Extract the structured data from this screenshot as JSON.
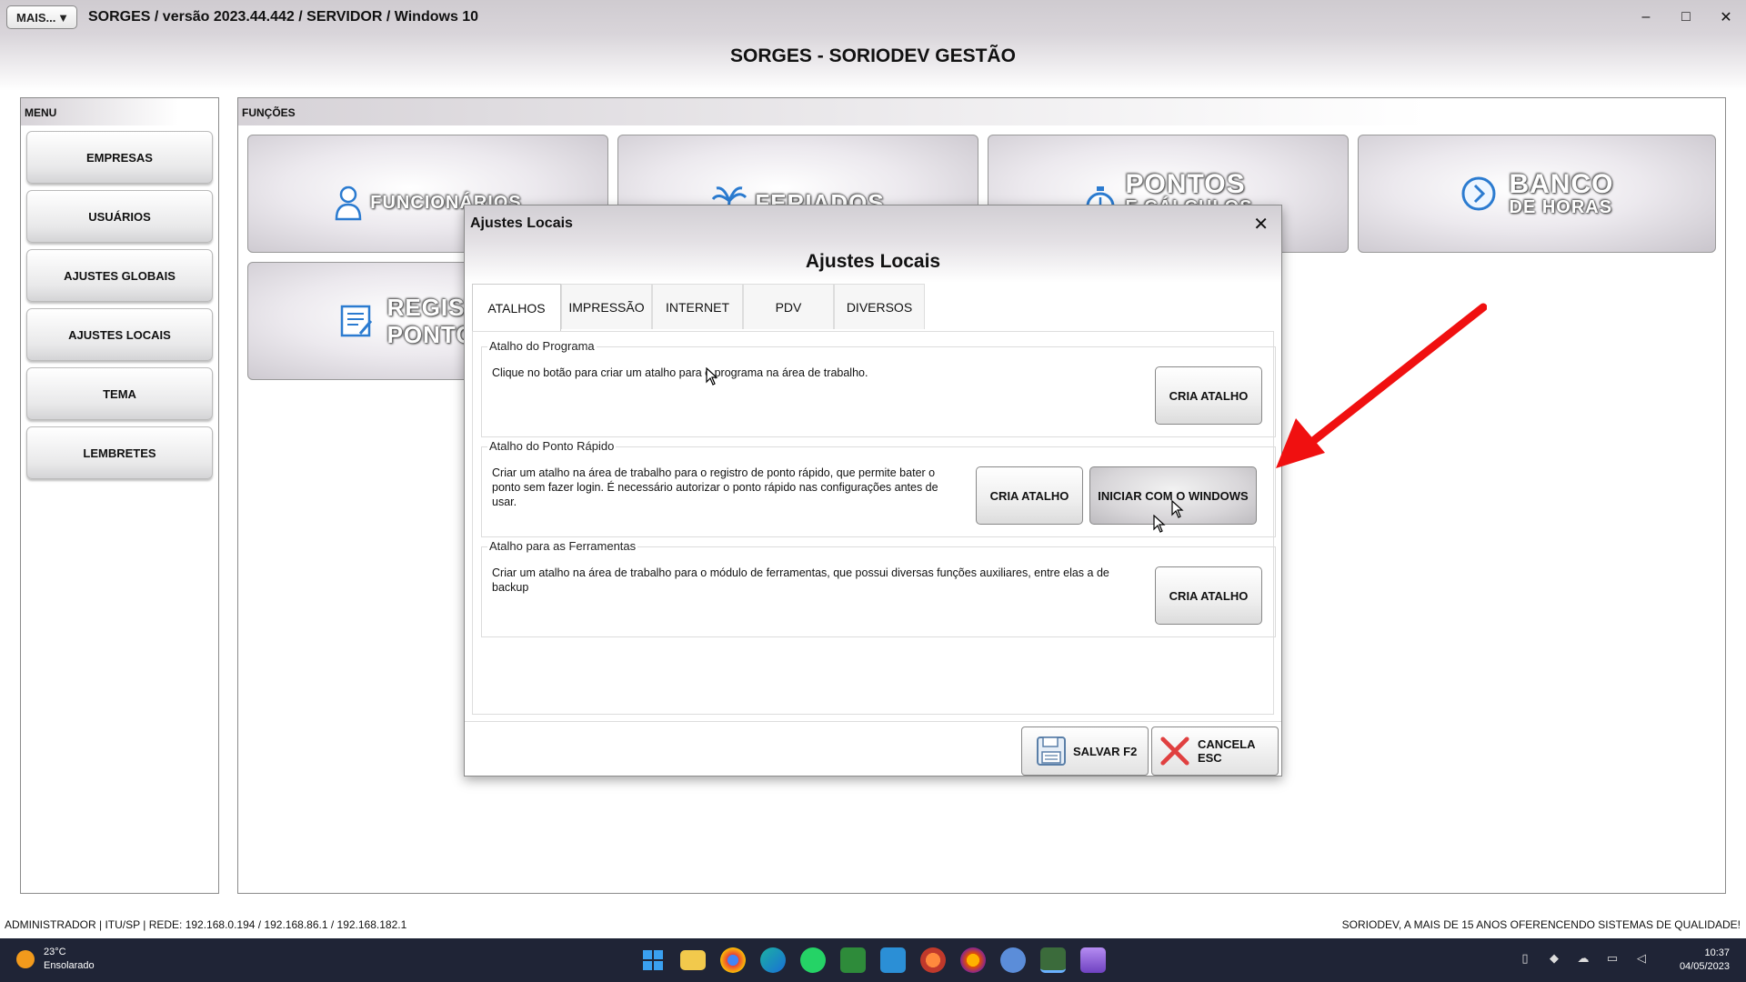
{
  "window": {
    "mais_label": "MAIS...",
    "title": "SORGES / versão 2023.44.442 / SERVIDOR / Windows 10",
    "minimize": "–",
    "maximize": "□",
    "close": "✕"
  },
  "header": {
    "title": "SORGES - SORIODEV GESTÃO"
  },
  "menu": {
    "heading": "MENU",
    "items": [
      {
        "label": "EMPRESAS"
      },
      {
        "label": "USUÁRIOS"
      },
      {
        "label": "AJUSTES GLOBAIS"
      },
      {
        "label": "AJUSTES LOCAIS"
      },
      {
        "label": "TEMA"
      },
      {
        "label": "LEMBRETES"
      }
    ]
  },
  "functions": {
    "heading": "FUNÇÕES",
    "tiles": [
      {
        "line1": "FUNCIONÁRIOS",
        "icon": "employee-icon"
      },
      {
        "line1": "FERIADOS",
        "icon": "palm-tree-icon"
      },
      {
        "line1": "PONTOS",
        "line2": "E CÁLCULOS",
        "icon": "stopwatch-icon"
      },
      {
        "line1": "BANCO",
        "line2": "DE HORAS",
        "icon": "clock-arrow-icon"
      },
      {
        "line1": "REGISTRO",
        "line2": "PONTO",
        "icon": "register-icon"
      }
    ]
  },
  "dialog": {
    "window_title": "Ajustes Locais",
    "close": "✕",
    "header": "Ajustes Locais",
    "tabs": [
      {
        "label": "ATALHOS",
        "active": true
      },
      {
        "label": "IMPRESSÃO"
      },
      {
        "label": "INTERNET"
      },
      {
        "label": "PDV"
      },
      {
        "label": "DIVERSOS"
      }
    ],
    "groups": [
      {
        "legend": "Atalho do Programa",
        "text": "Clique no botão para criar um atalho para o programa na área de trabalho.",
        "button": "CRIA ATALHO"
      },
      {
        "legend": "Atalho do Ponto Rápido",
        "text": "Criar um atalho na área de trabalho para o registro de ponto rápido, que permite bater o ponto sem fazer login. É necessário autorizar o ponto rápido nas configurações antes de usar.",
        "button": "CRIA ATALHO",
        "button2": "INICIAR COM O WINDOWS"
      },
      {
        "legend": "Atalho para as Ferramentas",
        "text": "Criar um atalho na área de trabalho para o módulo de ferramentas, que possui diversas funções auxiliares, entre elas a de backup",
        "button": "CRIA ATALHO"
      }
    ],
    "save_label": "SALVAR F2",
    "cancel_label": "CANCELA ESC"
  },
  "status": {
    "left": "ADMINISTRADOR |   ITU/SP |    REDE: 192.168.0.194 / 192.168.86.1 / 192.168.182.1",
    "right": "SORIODEV, A MAIS DE 15 ANOS OFERENCENDO SISTEMAS DE QUALIDADE!"
  },
  "taskbar": {
    "temperature": "23°C",
    "weather": "Ensolarado",
    "time": "10:37",
    "date": "04/05/2023"
  },
  "colors": {
    "arrow": "#f01010",
    "taskbar": "#1f2436"
  }
}
